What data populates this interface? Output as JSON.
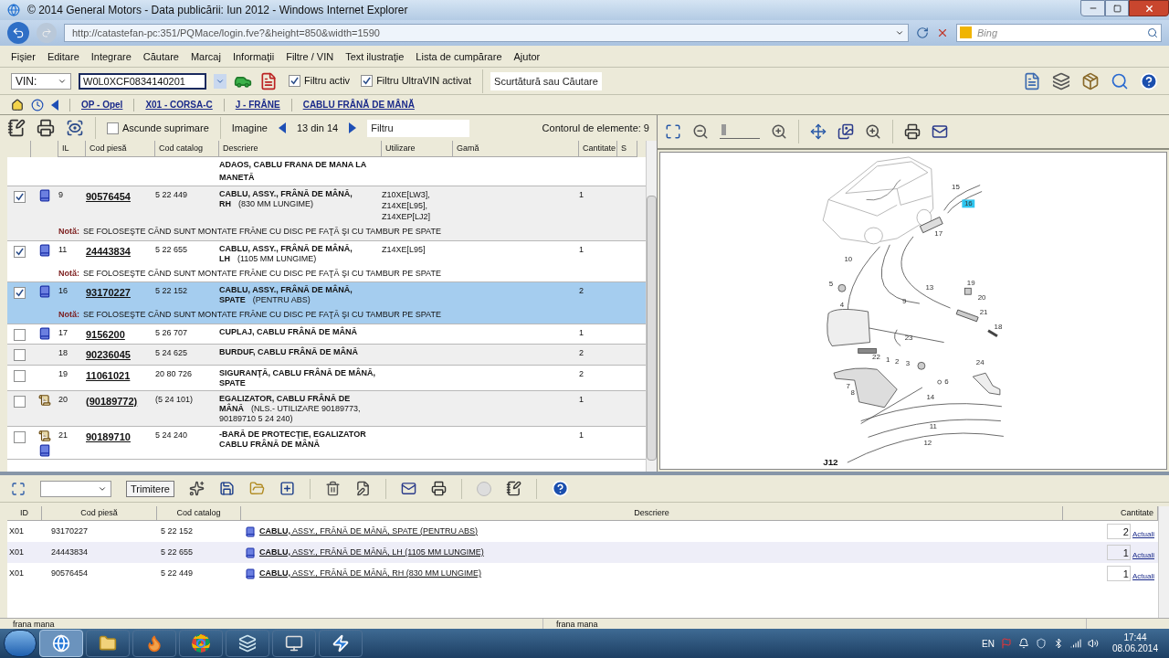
{
  "window": {
    "title": "© 2014 General Motors - Data publicării: Iun 2012 - Windows Internet Explorer"
  },
  "address_bar": {
    "url": "http://catastefan-pc:351/PQMace/login.fve?&height=850&width=1590",
    "search_placeholder": "Bing"
  },
  "menu": [
    "Fişier",
    "Editare",
    "Integrare",
    "Căutare",
    "Marcaj",
    "Informaţii",
    "Filtre / VIN",
    "Text ilustraţie",
    "Lista de cumpărare",
    "Ajutor"
  ],
  "toolbar": {
    "vin_select": "VIN:",
    "vin_value": "W0L0XCF0834140201",
    "filters": [
      {
        "label": "Filtru activ",
        "checked": true
      },
      {
        "label": "Filtru UltraVIN activat",
        "checked": true
      }
    ],
    "search_placeholder": "Scurtătură sau Căutare"
  },
  "breadcrumb": [
    "OP - Opel",
    "X01 - CORSA-C",
    "J - FRÂNE",
    "CABLU FRÂNĂ DE MÂNĂ"
  ],
  "parts": {
    "hide_suppressed": {
      "label": "Ascunde suprimare",
      "checked": false
    },
    "image_label": "Imagine",
    "image_pos": "13 din 14",
    "filter_placeholder": "Filtru",
    "count": "Contorul de elemente: 9",
    "columns": [
      "IL",
      "Cod piesă",
      "Cod catalog",
      "Descriere",
      "Utilizare",
      "Gamă",
      "Cantitate",
      "S"
    ],
    "rows": [
      {
        "kind": "partial",
        "description": "ADAOS, CABLU FRANA DE MANA LA MANETĂ",
        "selected": false
      },
      {
        "kind": "book",
        "checked": true,
        "il": "9",
        "code": "90576454",
        "catalog": "5 22 449",
        "description": "CABLU, ASSY., FRÂNĂ DE MÂNĂ, RH",
        "detail": "(830 MM LUNGIME)",
        "usage": [
          "Z10XE[LW3],",
          "Z14XE[L95],",
          "Z14XEP[LJ2]"
        ],
        "quantity": "1",
        "note_label": "Notă:",
        "note": "SE FOLOSEŞTE CÂND SUNT MONTATE FRÂNE CU DISC PE FAŢĂ ŞI CU TAMBUR PE SPATE",
        "selected": false
      },
      {
        "kind": "book",
        "checked": true,
        "il": "11",
        "code": "24443834",
        "catalog": "5 22 655",
        "description": "CABLU, ASSY., FRÂNĂ DE MÂNĂ, LH",
        "detail": "(1105 MM LUNGIME)",
        "usage": [
          "Z14XE[L95]"
        ],
        "quantity": "1",
        "note_label": "Notă:",
        "note": "SE FOLOSEŞTE CÂND SUNT MONTATE FRÂNE CU DISC PE FAŢĂ ŞI CU TAMBUR PE SPATE",
        "selected": false
      },
      {
        "kind": "book",
        "checked": true,
        "il": "16",
        "code": "93170227",
        "catalog": "5 22 152",
        "description": "CABLU, ASSY., FRÂNĂ DE MÂNĂ, SPATE",
        "detail": "(PENTRU ABS)",
        "quantity": "2",
        "note_label": "Notă:",
        "note": "SE FOLOSEŞTE CÂND SUNT MONTATE FRÂNE CU DISC PE FAŢĂ ŞI CU TAMBUR PE SPATE",
        "selected": true
      },
      {
        "kind": "book",
        "checked": false,
        "il": "17",
        "code": "9156200",
        "catalog": "5 26 707",
        "description": "CUPLAJ, CABLU FRÂNĂ DE MÂNĂ",
        "quantity": "1",
        "selected": false
      },
      {
        "kind": "plain",
        "checked": false,
        "il": "18",
        "code": "90236045",
        "catalog": "5 24 625",
        "description": "BURDUF, CABLU FRÂNĂ DE MÂNĂ",
        "quantity": "2",
        "selected": false
      },
      {
        "kind": "plain",
        "checked": false,
        "il": "19",
        "code": "11061021",
        "catalog": "20 80 726",
        "description": "SIGURANŢĂ, CABLU FRÂNĂ DE MÂNĂ, SPATE",
        "quantity": "2",
        "selected": false
      },
      {
        "kind": "scroll",
        "checked": false,
        "il": "20",
        "code": "(90189772)",
        "catalog": "(5 24 101)",
        "description": "EGALIZATOR, CABLU FRÂNĂ DE MÂNĂ",
        "detail": "(NLS.- UTILIZARE 90189773, 90189710 5 24 240)",
        "quantity": "1",
        "selected": false
      },
      {
        "kind": "scroll_book",
        "checked": false,
        "il": "21",
        "code": "90189710",
        "catalog": "5 24 240",
        "description": "-BARĂ DE PROTECŢIE, EGALIZATOR CABLU FRÂNĂ DE MÂNĂ",
        "quantity": "1",
        "selected": false
      }
    ]
  },
  "diagram": {
    "label": "J12",
    "zoom": {
      "level": 0.05
    },
    "callouts": [
      {
        "label": "15",
        "selected": false
      },
      {
        "label": "16",
        "selected": true
      },
      {
        "label": "17",
        "selected": false
      },
      {
        "label": "10",
        "selected": false
      },
      {
        "label": "13",
        "selected": false
      },
      {
        "label": "19",
        "selected": false
      },
      {
        "label": "5",
        "selected": false
      },
      {
        "label": "20",
        "selected": false
      },
      {
        "label": "9",
        "selected": false
      },
      {
        "label": "21",
        "selected": false
      },
      {
        "label": "4",
        "selected": false
      },
      {
        "label": "18",
        "selected": false
      },
      {
        "label": "23",
        "selected": false
      },
      {
        "label": "22",
        "selected": false
      },
      {
        "label": "1",
        "selected": false
      },
      {
        "label": "2",
        "selected": false
      },
      {
        "label": "3",
        "selected": false
      },
      {
        "label": "24",
        "selected": false
      },
      {
        "label": "6",
        "selected": false
      },
      {
        "label": "7",
        "selected": false
      },
      {
        "label": "8",
        "selected": false
      },
      {
        "label": "14",
        "selected": false
      },
      {
        "label": "11",
        "selected": false
      },
      {
        "label": "12",
        "selected": false
      }
    ]
  },
  "basket": {
    "send_button": "Trimitere",
    "columns": [
      "ID",
      "Cod piesă",
      "Cod catalog",
      "Descriere",
      "Cantitate"
    ],
    "rows": [
      {
        "id": "X01",
        "code": "93170227",
        "catalog": "5 22 152",
        "description": "**CABLU,** ASSY., FRÂNĂ DE MÂNĂ, SPATE (PENTRU ABS)",
        "quantity": "2",
        "link": "Actuali"
      },
      {
        "id": "X01",
        "code": "24443834",
        "catalog": "5 22 655",
        "description": "**CABLU,** ASSY., FRÂNĂ DE MÂNĂ, LH (1105 MM LUNGIME)",
        "quantity": "1",
        "link": "Actuali"
      },
      {
        "id": "X01",
        "code": "90576454",
        "catalog": "5 22 449",
        "description": "**CABLU,** ASSY., FRÂNĂ DE MÂNĂ, RH (830 MM LUNGIME)",
        "quantity": "1",
        "link": "Actuali"
      }
    ]
  },
  "status_bar": [
    "frana mana",
    "frana mana"
  ],
  "taskbar": {
    "language": "EN",
    "time": "17:44",
    "date": "08.06.2014"
  }
}
